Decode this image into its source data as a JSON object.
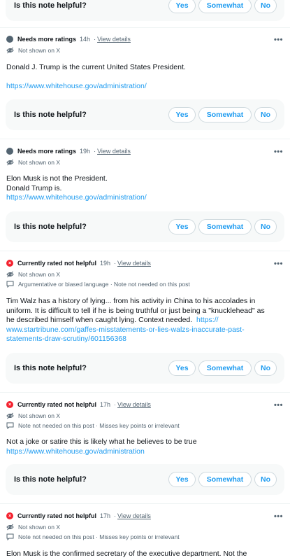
{
  "question": "Is this note helpful?",
  "buttons": {
    "yes": "Yes",
    "somewhat": "Somewhat",
    "no": "No"
  },
  "view_details": "View details",
  "not_shown": "Not shown on X",
  "more": "•••",
  "notes": [
    {
      "status": "Needs more ratings",
      "time": "14h",
      "line1": "Donald J. Trump is the current United States President.",
      "link": "https://www.whitehouse.gov/administration/"
    },
    {
      "status": "Needs more ratings",
      "time": "19h",
      "line1": "Elon Musk is not the President.",
      "line2": "Donald Trump is.",
      "link": "https://www.whitehouse.gov/administration/"
    },
    {
      "status": "Currently rated not helpful",
      "time": "19h",
      "reason": "Argumentative or biased language · Note not needed on this post",
      "line1": "Tim Walz has a history of lying... from his activity in China to his accolades in",
      "line2": "uniform.  It is difficult to tell if he is being truthful or just being a \"knucklehead\" as",
      "line3": "he described himself when caught lying.  Context needed.",
      "link_a": "https://",
      "link_b": "www.startribune.com/gaffes-misstatements-or-lies-walzs-inaccurate-past-",
      "link_c": "statements-draw-scrutiny/601156368"
    },
    {
      "status": "Currently rated not helpful",
      "time": "17h",
      "reason": "Note not needed on this post · Misses key points or irrelevant",
      "line1": "Not a joke or satire this is likely what he believes to be true",
      "link": "https://www.whitehouse.gov/administration"
    },
    {
      "status": "Currently rated not helpful",
      "time": "17h",
      "reason": "Note not needed on this post · Misses key points or irrelevant",
      "line1": "Elon Musk is the confirmed secretary of the executive department. Not the"
    }
  ],
  "colors": {
    "accent": "#1d9bf0",
    "needs_more": "#536471",
    "not_helpful": "#f4212e",
    "panel": "#f7f9f9"
  }
}
